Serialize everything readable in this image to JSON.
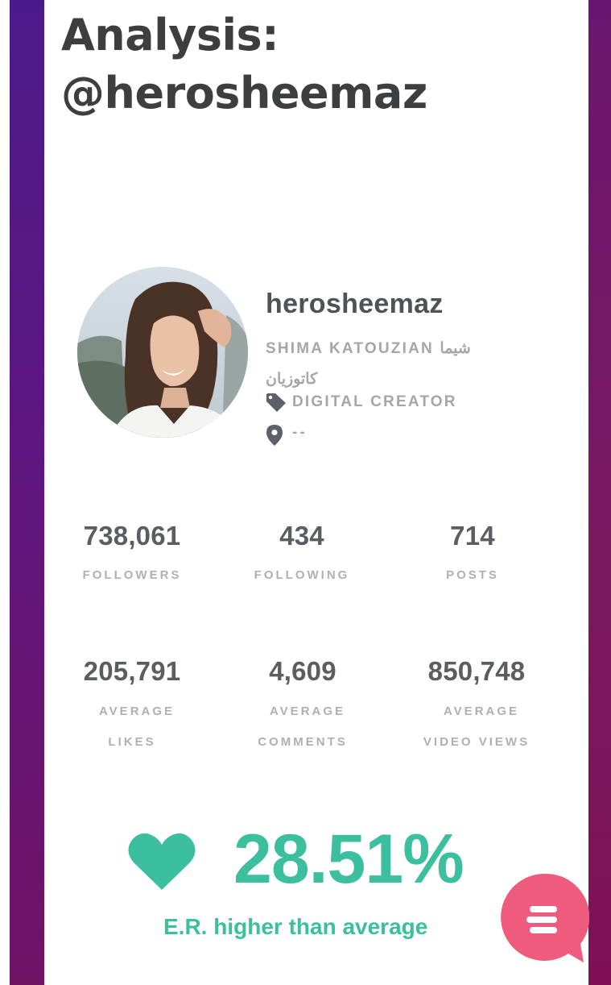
{
  "page": {
    "title_line1": "Analysis:",
    "title_line2": "@herosheemaz"
  },
  "profile": {
    "username": "herosheemaz",
    "full_name": "SHIMA KATOUZIAN شیما کاتوزیان",
    "category": "DIGITAL CREATOR",
    "location": "--",
    "icons": {
      "category": "tag-icon",
      "location": "map-pin-icon"
    }
  },
  "stats": [
    {
      "value": "738,061",
      "label_line1": "FOLLOWERS",
      "label_line2": ""
    },
    {
      "value": "434",
      "label_line1": "FOLLOWING",
      "label_line2": ""
    },
    {
      "value": "714",
      "label_line1": "POSTS",
      "label_line2": ""
    },
    {
      "value": "205,791",
      "label_line1": "AVERAGE",
      "label_line2": "LIKES"
    },
    {
      "value": "4,609",
      "label_line1": "AVERAGE",
      "label_line2": "COMMENTS"
    },
    {
      "value": "850,748",
      "label_line1": "AVERAGE",
      "label_line2": "VIDEO VIEWS"
    }
  ],
  "engagement": {
    "value": "28.51%",
    "caption": "E.R. higher than average",
    "icon": "heart-icon"
  },
  "chat_button": {
    "icon": "chat-bubble-icon"
  },
  "colors": {
    "accent_green": "#3bbf9e",
    "chat_pink": "#ef5b7c",
    "background_purple": "#5a1a84",
    "text_dark": "#3c3e40",
    "text_muted": "#a4a6ab"
  }
}
